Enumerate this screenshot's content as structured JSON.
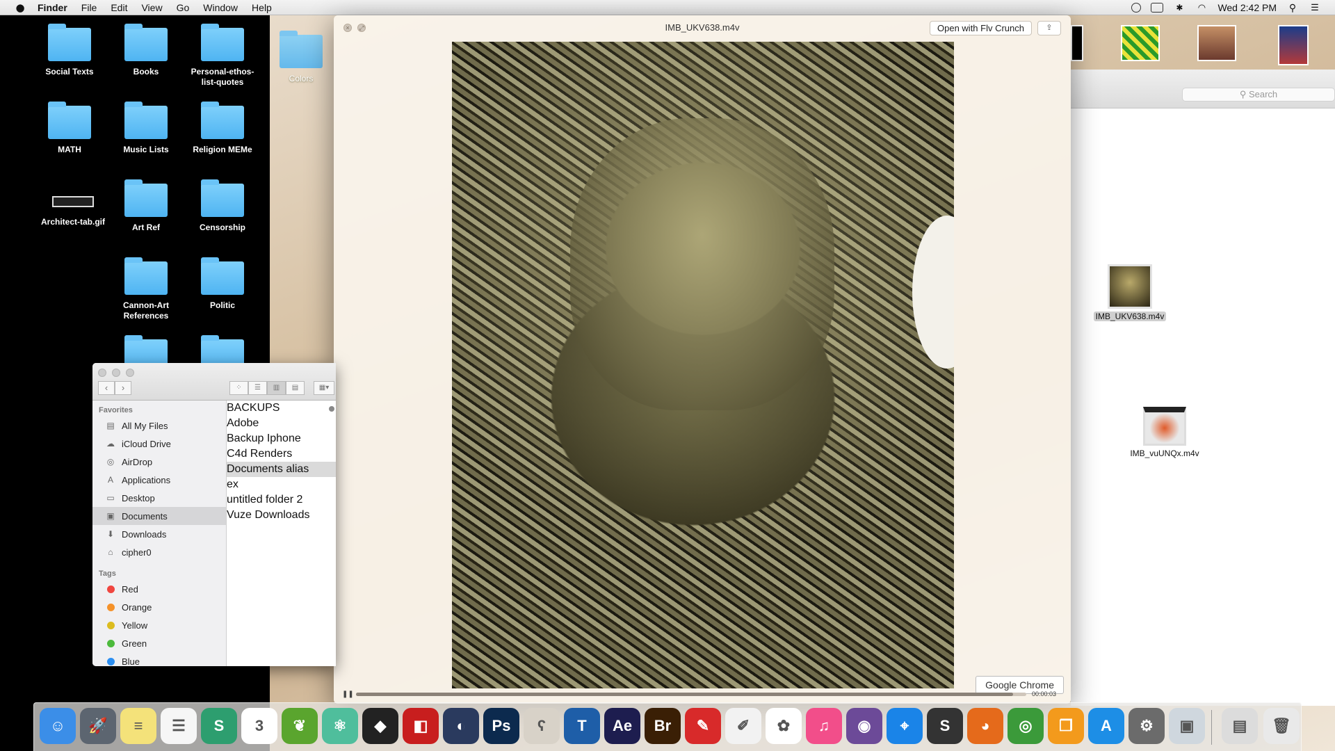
{
  "menubar": {
    "app_name": "Finder",
    "menus": [
      "File",
      "Edit",
      "View",
      "Go",
      "Window",
      "Help"
    ],
    "clock": "Wed 2:42 PM"
  },
  "desktop": {
    "icons": [
      {
        "label": "Social Texts"
      },
      {
        "label": "Books"
      },
      {
        "label": "Personal-ethos-\nlist-quotes"
      },
      {
        "label": "MATH"
      },
      {
        "label": "Music Lists"
      },
      {
        "label": "Religion MEMe"
      },
      {
        "label": "Architect-tab.gif"
      },
      {
        "label": "Art Ref"
      },
      {
        "label": "Censorship"
      },
      {
        "label": "Cannon-Art\nReferences"
      },
      {
        "label": "Politic"
      },
      {
        "label": "Colors"
      }
    ]
  },
  "quicklook": {
    "title": "IMB_UKV638.m4v",
    "open_button": "Open with Flv Crunch",
    "share_icon": "share-icon",
    "tooltip": "Google Chrome",
    "elapsed": "00:00:03",
    "progress": 0.98
  },
  "finder": {
    "favorites_header": "Favorites",
    "favorites": [
      {
        "label": "All My Files",
        "icon": "all-files-icon"
      },
      {
        "label": "iCloud Drive",
        "icon": "cloud-icon"
      },
      {
        "label": "AirDrop",
        "icon": "airdrop-icon"
      },
      {
        "label": "Applications",
        "icon": "applications-icon"
      },
      {
        "label": "Desktop",
        "icon": "desktop-icon"
      },
      {
        "label": "Documents",
        "icon": "documents-icon",
        "selected": true
      },
      {
        "label": "Downloads",
        "icon": "downloads-icon"
      },
      {
        "label": "cipher0",
        "icon": "home-icon"
      }
    ],
    "tags_header": "Tags",
    "tags": [
      {
        "label": "Red",
        "color": "#f0463f"
      },
      {
        "label": "Orange",
        "color": "#f5922a"
      },
      {
        "label": "Yellow",
        "color": "#dcbc1f"
      },
      {
        "label": "Green",
        "color": "#4cba3c"
      },
      {
        "label": "Blue",
        "color": "#2c8ff2"
      }
    ],
    "files": [
      {
        "name": "BACKUPS"
      },
      {
        "name": "Adobe"
      },
      {
        "name": "Backup Iphone"
      },
      {
        "name": "C4d Renders"
      },
      {
        "name": "Documents alias",
        "selected": true
      },
      {
        "name": "ex"
      },
      {
        "name": "untitled folder 2"
      },
      {
        "name": "Vuze Downloads"
      }
    ]
  },
  "right_window": {
    "search_placeholder": "Search",
    "files": [
      {
        "name": "IMB_UKV638.m4v",
        "selected": true
      },
      {
        "name": "IMB_vuUNQx.m4v",
        "selected": false
      }
    ]
  },
  "dock": {
    "apps": [
      {
        "name": "finder",
        "color": "#3b8ee8",
        "glyph": "☺"
      },
      {
        "name": "launchpad",
        "color": "#5c6570",
        "glyph": "🚀"
      },
      {
        "name": "notes",
        "color": "#f4e27a",
        "glyph": "≡"
      },
      {
        "name": "reminders",
        "color": "#f6f6f6",
        "glyph": "☰"
      },
      {
        "name": "slack",
        "color": "#2d9e6f",
        "glyph": "S"
      },
      {
        "name": "calendar",
        "color": "#ffffff",
        "glyph": "3"
      },
      {
        "name": "leaf",
        "color": "#5aa52e",
        "glyph": "❦"
      },
      {
        "name": "atom",
        "color": "#4fbe9c",
        "glyph": "⚛"
      },
      {
        "name": "unity",
        "color": "#222222",
        "glyph": "◆"
      },
      {
        "name": "sketchup",
        "color": "#c81e1e",
        "glyph": "◧"
      },
      {
        "name": "cinema4d",
        "color": "#2a3a5e",
        "glyph": "◐"
      },
      {
        "name": "photoshop",
        "color": "#0c2a4e",
        "glyph": "Ps"
      },
      {
        "name": "bear",
        "color": "#d8d2c8",
        "glyph": "ʕ"
      },
      {
        "name": "tetris",
        "color": "#1e5ea8",
        "glyph": "T"
      },
      {
        "name": "aftereffects",
        "color": "#1d1d4f",
        "glyph": "Ae"
      },
      {
        "name": "bridge",
        "color": "#3a1f05",
        "glyph": "Br"
      },
      {
        "name": "pdf",
        "color": "#d82a2a",
        "glyph": "✎"
      },
      {
        "name": "textedit",
        "color": "#f2f2f2",
        "glyph": "✐"
      },
      {
        "name": "photos",
        "color": "#ffffff",
        "glyph": "✿"
      },
      {
        "name": "itunes",
        "color": "#f24e8a",
        "glyph": "♫"
      },
      {
        "name": "github",
        "color": "#6c4a98",
        "glyph": "◉"
      },
      {
        "name": "safari",
        "color": "#1a84e8",
        "glyph": "⌖"
      },
      {
        "name": "sublime",
        "color": "#333333",
        "glyph": "S"
      },
      {
        "name": "firefox",
        "color": "#e56a1b",
        "glyph": "◕"
      },
      {
        "name": "chrome",
        "color": "#3b9a3a",
        "glyph": "◎"
      },
      {
        "name": "ibooks",
        "color": "#f39a1c",
        "glyph": "❐"
      },
      {
        "name": "appstore",
        "color": "#1d8ee6",
        "glyph": "A"
      },
      {
        "name": "systemprefs",
        "color": "#6b6b6b",
        "glyph": "⚙"
      },
      {
        "name": "preview",
        "color": "#cfd7de",
        "glyph": "▣"
      }
    ],
    "right": [
      {
        "name": "scanner",
        "color": "#dcdcdc",
        "glyph": "▤"
      },
      {
        "name": "trash",
        "color": "#e9e9e9",
        "glyph": "🗑"
      }
    ]
  }
}
